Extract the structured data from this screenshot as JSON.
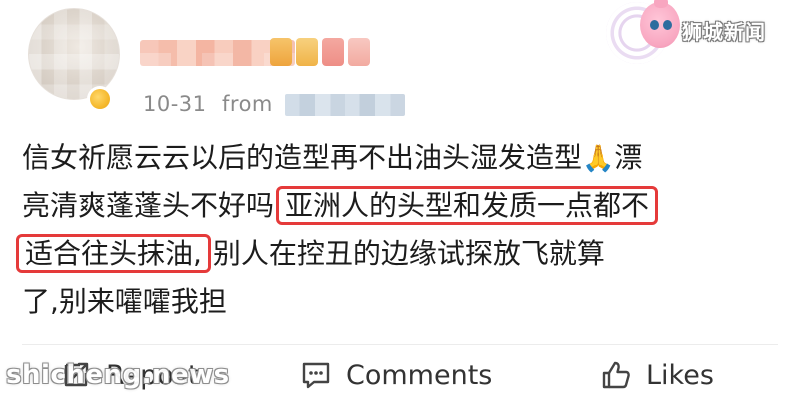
{
  "header": {
    "avatar": "avatar-blurred",
    "username": "",
    "timestamp": "10-31",
    "from_label": "from",
    "source": ""
  },
  "watermark": {
    "top_right": "狮城新闻",
    "bottom_left": "shicheng.news"
  },
  "post": {
    "line1_text": "信女祈愿云云以后的造型再不出油头湿发造型",
    "line1_emoji": "🙏",
    "line1_tail": "漂",
    "line2_text": "亮清爽蓬蓬头不好吗",
    "line2_highlight": "亚洲人的头型和发质一点都不",
    "line3_highlight": "适合往头抹油,",
    "line3_text": "别人在控丑的边缘试探放飞就算",
    "line4_text": "了,别来嚯嚯我担"
  },
  "actions": {
    "repost_label": "Repost",
    "comments_label": "Comments",
    "likes_label": "Likes"
  },
  "colors": {
    "highlight_border": "#e53a3a",
    "meta_text": "#8a8a8a",
    "body_text": "#1c1c1c"
  },
  "icons": {
    "repost": "repost-icon",
    "comments": "comment-icon",
    "likes": "thumbs-up-icon",
    "verified": "verified-badge-icon",
    "logo": "mascot-logo-icon"
  }
}
